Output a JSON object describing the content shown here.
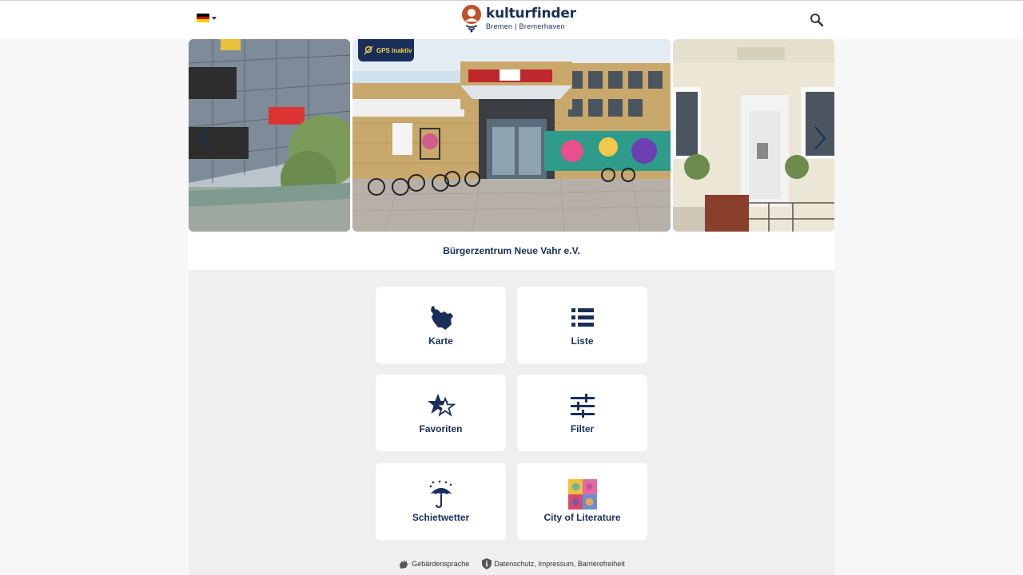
{
  "header": {
    "language": {
      "code": "de",
      "flag_colors": [
        "#000000",
        "#dd0000",
        "#ffce00"
      ]
    },
    "logo": {
      "name": "kulturfinder",
      "subtitle": "Bremen | Bremerhaven"
    },
    "search_icon": "search-icon"
  },
  "carousel": {
    "gps_badge": "GPS inaktiv",
    "current_caption": "Bürgerzentrum Neue Vahr e.V.",
    "prev_icon": "chevron-left-icon",
    "next_icon": "chevron-right-icon"
  },
  "tiles": [
    {
      "label": "Karte",
      "icon": "map-icon"
    },
    {
      "label": "Liste",
      "icon": "list-icon"
    },
    {
      "label": "Favoriten",
      "icon": "star-icon"
    },
    {
      "label": "Filter",
      "icon": "sliders-icon"
    },
    {
      "label": "Schietwetter",
      "icon": "umbrella-icon"
    },
    {
      "label": "City of Literature",
      "icon": "city-of-literature-icon"
    }
  ],
  "footer": {
    "sign_language": "Gebärdensprache",
    "legal": "Datenschutz, Impressum, Barrierefreiheit"
  },
  "colors": {
    "brand": "#1a2e5a",
    "accent": "#f5d04a",
    "logo_orange": "#c0522b"
  }
}
